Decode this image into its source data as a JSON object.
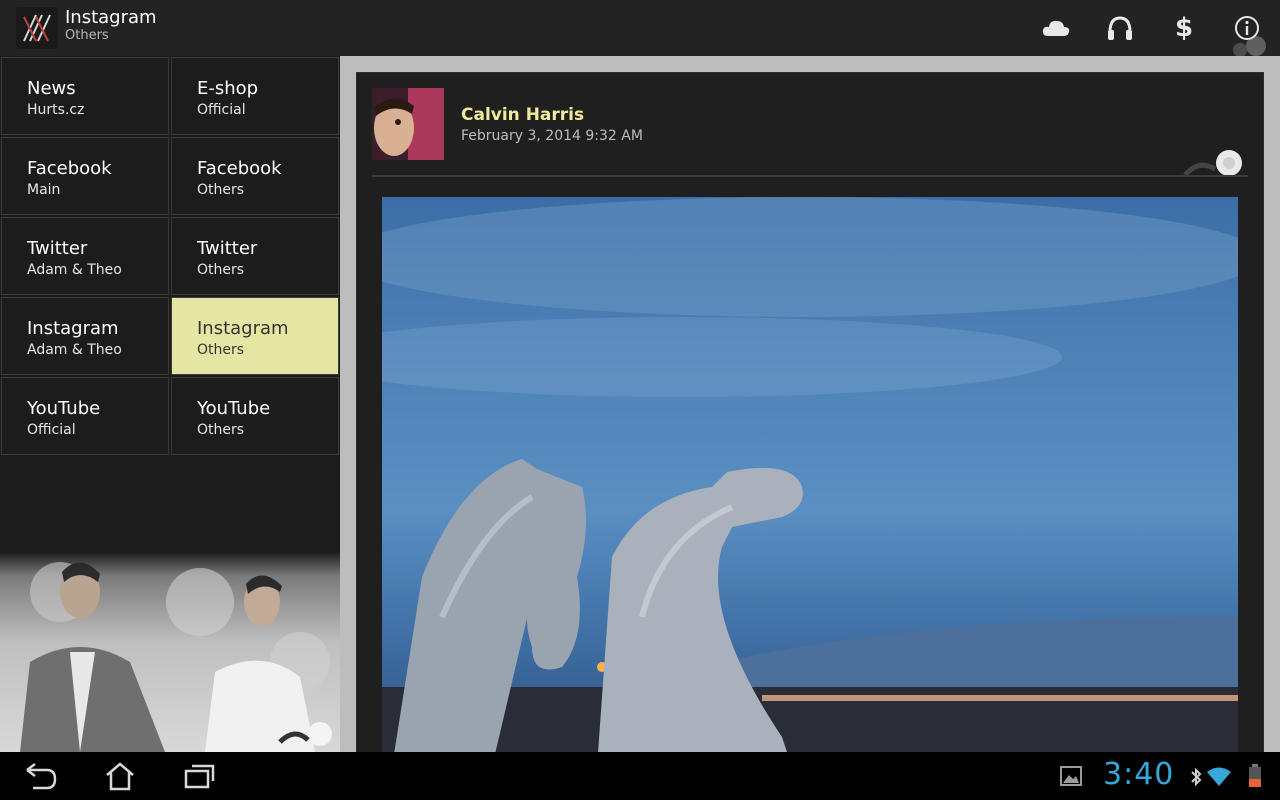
{
  "actionbar": {
    "title": "Instagram",
    "subtitle": "Others",
    "actions": [
      "cloud-icon",
      "headphones-icon",
      "dollar-icon",
      "info-icon"
    ],
    "dollar_label": "$"
  },
  "sidebar": {
    "tiles": [
      {
        "title": "News",
        "subtitle": "Hurts.cz"
      },
      {
        "title": "E-shop",
        "subtitle": "Official"
      },
      {
        "title": "Facebook",
        "subtitle": "Main"
      },
      {
        "title": "Facebook",
        "subtitle": "Others"
      },
      {
        "title": "Twitter",
        "subtitle": "Adam & Theo"
      },
      {
        "title": "Twitter",
        "subtitle": "Others"
      },
      {
        "title": "Instagram",
        "subtitle": "Adam & Theo"
      },
      {
        "title": "Instagram",
        "subtitle": "Others"
      },
      {
        "title": "YouTube",
        "subtitle": "Official"
      },
      {
        "title": "YouTube",
        "subtitle": "Others"
      }
    ],
    "selected_index": 7
  },
  "post": {
    "author": "Calvin Harris",
    "date": "February 3, 2014 9:32 AM"
  },
  "statusbar": {
    "clock": "3:40"
  },
  "colors": {
    "selected_tile": "#e5e6a3",
    "author_name": "#f1ec9a",
    "clock": "#36a7d9"
  }
}
